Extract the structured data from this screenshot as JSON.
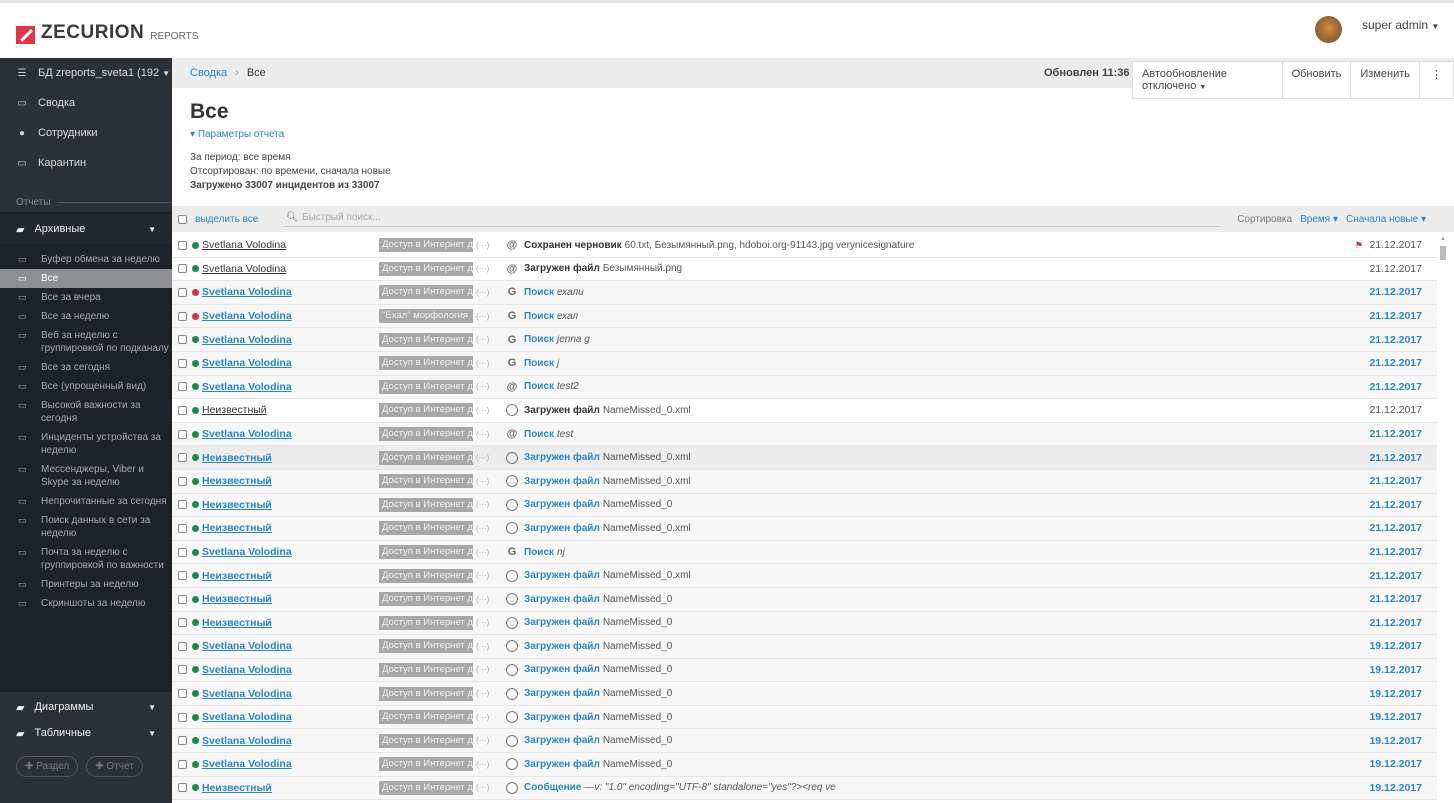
{
  "header": {
    "brand": "ZECURION",
    "product": "REPORTS",
    "user": "super admin"
  },
  "sidebar": {
    "db": "БД zreports_sveta1 (192",
    "nav": [
      {
        "label": "Сводка",
        "icon": "laptop-icon"
      },
      {
        "label": "Сотрудники",
        "icon": "user-icon"
      },
      {
        "label": "Карантин",
        "icon": "inbox-icon"
      }
    ],
    "section": "Отчеты",
    "folders": {
      "archive": "Архивные",
      "charts": "Диаграммы",
      "tables": "Табличные"
    },
    "reports": [
      "Буфер обмена за неделю",
      "Все",
      "Все за вчера",
      "Все за неделю",
      "Веб за неделю с группировкой по подканалу",
      "Все за сегодня",
      "Все (упрощенный вид)",
      "Высокой важности за сегодня",
      "Инциденты устройства за неделю",
      "Мессенджеры, Viber и Skype за неделю",
      "Непрочитанные за сегодня",
      "Поиск данных в сети за неделю",
      "Почта за неделю с группировкой по важности",
      "Принтеры за неделю",
      "Скриншоты за неделю"
    ],
    "active_report": 1,
    "add_section": "Раздел",
    "add_report": "Отчет"
  },
  "breadcrumb": {
    "root": "Сводка",
    "current": "Все"
  },
  "toolbar": {
    "updated": "Обновлен 11:36",
    "autoupdate": "Автообновление отключено",
    "refresh": "Обновить",
    "edit": "Изменить"
  },
  "page": {
    "title": "Все",
    "params": "Параметры отчета",
    "period": "За период: все время",
    "sorted": "Отсортирован: по времени, сначала новые",
    "loaded": "Загружено 33007 инцидентов из 33007"
  },
  "list_toolbar": {
    "select_all": "выделить все",
    "search_placeholder": "Быстрый поиск...",
    "sort_label": "Сортировка",
    "sort_field": "Время",
    "sort_order": "Сначала новые"
  },
  "colors": {
    "accent": "#2a86c9",
    "green": "#1a8a4a",
    "red": "#d0344a"
  },
  "rows": [
    {
      "name": "Svetlana Volodina",
      "read": true,
      "status": "green",
      "badge": "Доступ в Интернет д",
      "icon": "at",
      "action": "Сохранен черновик",
      "detail": "60.txt, Безымянный.png, hdoboi.org-91143.jpg verynicesignature",
      "flag": true,
      "date": "21.12.2017"
    },
    {
      "name": "Svetlana Volodina",
      "read": true,
      "status": "green",
      "badge": "Доступ в Интернет д",
      "icon": "at",
      "action": "Загружен файл",
      "detail": "Безымянный.png",
      "date": "21.12.2017"
    },
    {
      "name": "Svetlana Volodina",
      "status": "red",
      "badge": "Доступ в Интернет д",
      "icon": "google",
      "action": "Поиск",
      "detail": "ехали",
      "italic": true,
      "date": "21.12.2017"
    },
    {
      "name": "Svetlana Volodina",
      "status": "red",
      "badge": "\"Ехал\" морфология",
      "icon": "google",
      "action": "Поиск",
      "detail": "ехал",
      "italic": true,
      "date": "21.12.2017"
    },
    {
      "name": "Svetlana Volodina",
      "status": "green",
      "badge": "Доступ в Интернет д",
      "icon": "google",
      "action": "Поиск",
      "detail": "jenna g",
      "italic": true,
      "date": "21.12.2017"
    },
    {
      "name": "Svetlana Volodina",
      "status": "green",
      "badge": "Доступ в Интернет д",
      "icon": "google",
      "action": "Поиск",
      "detail": "j",
      "italic": true,
      "date": "21.12.2017"
    },
    {
      "name": "Svetlana Volodina",
      "status": "green",
      "badge": "Доступ в Интернет д",
      "icon": "at",
      "action": "Поиск",
      "detail": "test2",
      "italic": true,
      "date": "21.12.2017"
    },
    {
      "name": "Неизвестный",
      "read": true,
      "status": "green",
      "badge": "Доступ в Интернет д",
      "icon": "globe",
      "action": "Загружен файл",
      "detail": "NameMissed_0.xml",
      "date": "21.12.2017"
    },
    {
      "name": "Svetlana Volodina",
      "status": "green",
      "badge": "Доступ в Интернет д",
      "icon": "at",
      "action": "Поиск",
      "detail": "test",
      "italic": true,
      "date": "21.12.2017"
    },
    {
      "name": "Неизвестный",
      "status": "green",
      "highlight": true,
      "badge": "Доступ в Интернет д",
      "icon": "globe",
      "action": "Загружен файл",
      "detail": "NameMissed_0.xml",
      "date": "21.12.2017"
    },
    {
      "name": "Неизвестный",
      "status": "green",
      "badge": "Доступ в Интернет д",
      "icon": "globe",
      "action": "Загружен файл",
      "detail": "NameMissed_0.xml",
      "date": "21.12.2017"
    },
    {
      "name": "Неизвестный",
      "status": "green",
      "badge": "Доступ в Интернет д",
      "icon": "globe",
      "action": "Загружен файл",
      "detail": "NameMissed_0",
      "date": "21.12.2017"
    },
    {
      "name": "Неизвестный",
      "status": "green",
      "badge": "Доступ в Интернет д",
      "icon": "globe",
      "action": "Загружен файл",
      "detail": "NameMissed_0.xml",
      "date": "21.12.2017"
    },
    {
      "name": "Svetlana Volodina",
      "status": "green",
      "badge": "Доступ в Интернет д",
      "icon": "google",
      "action": "Поиск",
      "detail": "nj",
      "italic": true,
      "date": "21.12.2017"
    },
    {
      "name": "Неизвестный",
      "status": "green",
      "badge": "Доступ в Интернет д",
      "icon": "globe",
      "action": "Загружен файл",
      "detail": "NameMissed_0.xml",
      "date": "21.12.2017"
    },
    {
      "name": "Неизвестный",
      "status": "green",
      "badge": "Доступ в Интернет д",
      "icon": "globe",
      "action": "Загружен файл",
      "detail": "NameMissed_0",
      "date": "21.12.2017"
    },
    {
      "name": "Неизвестный",
      "status": "green",
      "badge": "Доступ в Интернет д",
      "icon": "globe",
      "action": "Загружен файл",
      "detail": "NameMissed_0",
      "date": "21.12.2017"
    },
    {
      "name": "Svetlana Volodina",
      "status": "green",
      "badge": "Доступ в Интернет д",
      "icon": "globe",
      "action": "Загружен файл",
      "detail": "NameMissed_0",
      "date": "19.12.2017"
    },
    {
      "name": "Svetlana Volodina",
      "status": "green",
      "badge": "Доступ в Интернет д",
      "icon": "globe",
      "action": "Загружен файл",
      "detail": "NameMissed_0",
      "date": "19.12.2017"
    },
    {
      "name": "Svetlana Volodina",
      "status": "green",
      "badge": "Доступ в Интернет д",
      "icon": "globe",
      "action": "Загружен файл",
      "detail": "NameMissed_0",
      "date": "19.12.2017"
    },
    {
      "name": "Svetlana Volodina",
      "status": "green",
      "badge": "Доступ в Интернет д",
      "icon": "globe",
      "action": "Загружен файл",
      "detail": "NameMissed_0",
      "date": "19.12.2017"
    },
    {
      "name": "Svetlana Volodina",
      "status": "green",
      "badge": "Доступ в Интернет д",
      "icon": "globe",
      "action": "Загружен файл",
      "detail": "NameMissed_0",
      "date": "19.12.2017"
    },
    {
      "name": "Svetlana Volodina",
      "status": "green",
      "badge": "Доступ в Интернет д",
      "icon": "globe",
      "action": "Загружен файл",
      "detail": "NameMissed_0",
      "date": "19.12.2017"
    },
    {
      "name": "Неизвестный",
      "status": "green",
      "badge": "Доступ в Интернет д",
      "icon": "globe",
      "action": "Сообщение",
      "detail": "—v: \"1.0\" encoding=\"UTF-8\" standalone=\"yes\"?><req ve",
      "italic": true,
      "date": "19.12.2017"
    }
  ]
}
